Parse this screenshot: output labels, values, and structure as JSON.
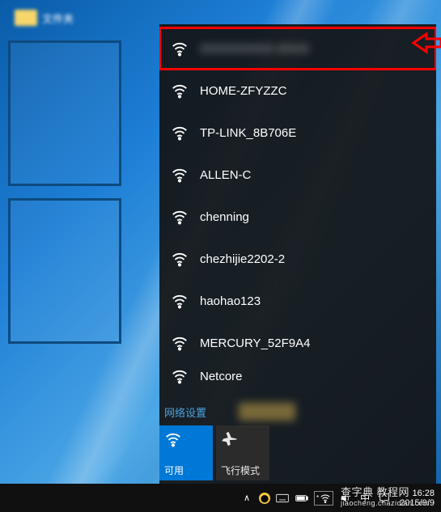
{
  "desktop": {
    "icon_label": "文件夹"
  },
  "wifiPanel": {
    "networks": [
      {
        "ssid": "XXXXXXXXX-XXXX",
        "highlighted": true
      },
      {
        "ssid": "HOME-ZFYZZC",
        "highlighted": false
      },
      {
        "ssid": "TP-LINK_8B706E",
        "highlighted": false
      },
      {
        "ssid": "ALLEN-C",
        "highlighted": false
      },
      {
        "ssid": "chenning",
        "highlighted": false
      },
      {
        "ssid": "chezhijie2202-2",
        "highlighted": false
      },
      {
        "ssid": "haohao123",
        "highlighted": false
      },
      {
        "ssid": "MERCURY_52F9A4",
        "highlighted": false
      },
      {
        "ssid": "Netcore",
        "highlighted": false
      }
    ],
    "settings_link": "网络设置",
    "tiles": {
      "wifi": {
        "label": "可用"
      },
      "airplane": {
        "label": "飞行模式"
      }
    }
  },
  "taskbar": {
    "clock": {
      "time": "16:28",
      "date": "2015/9/9"
    }
  },
  "watermark": {
    "main": "查字典 教程网",
    "sub": "jiaocheng.chazidian.com"
  }
}
